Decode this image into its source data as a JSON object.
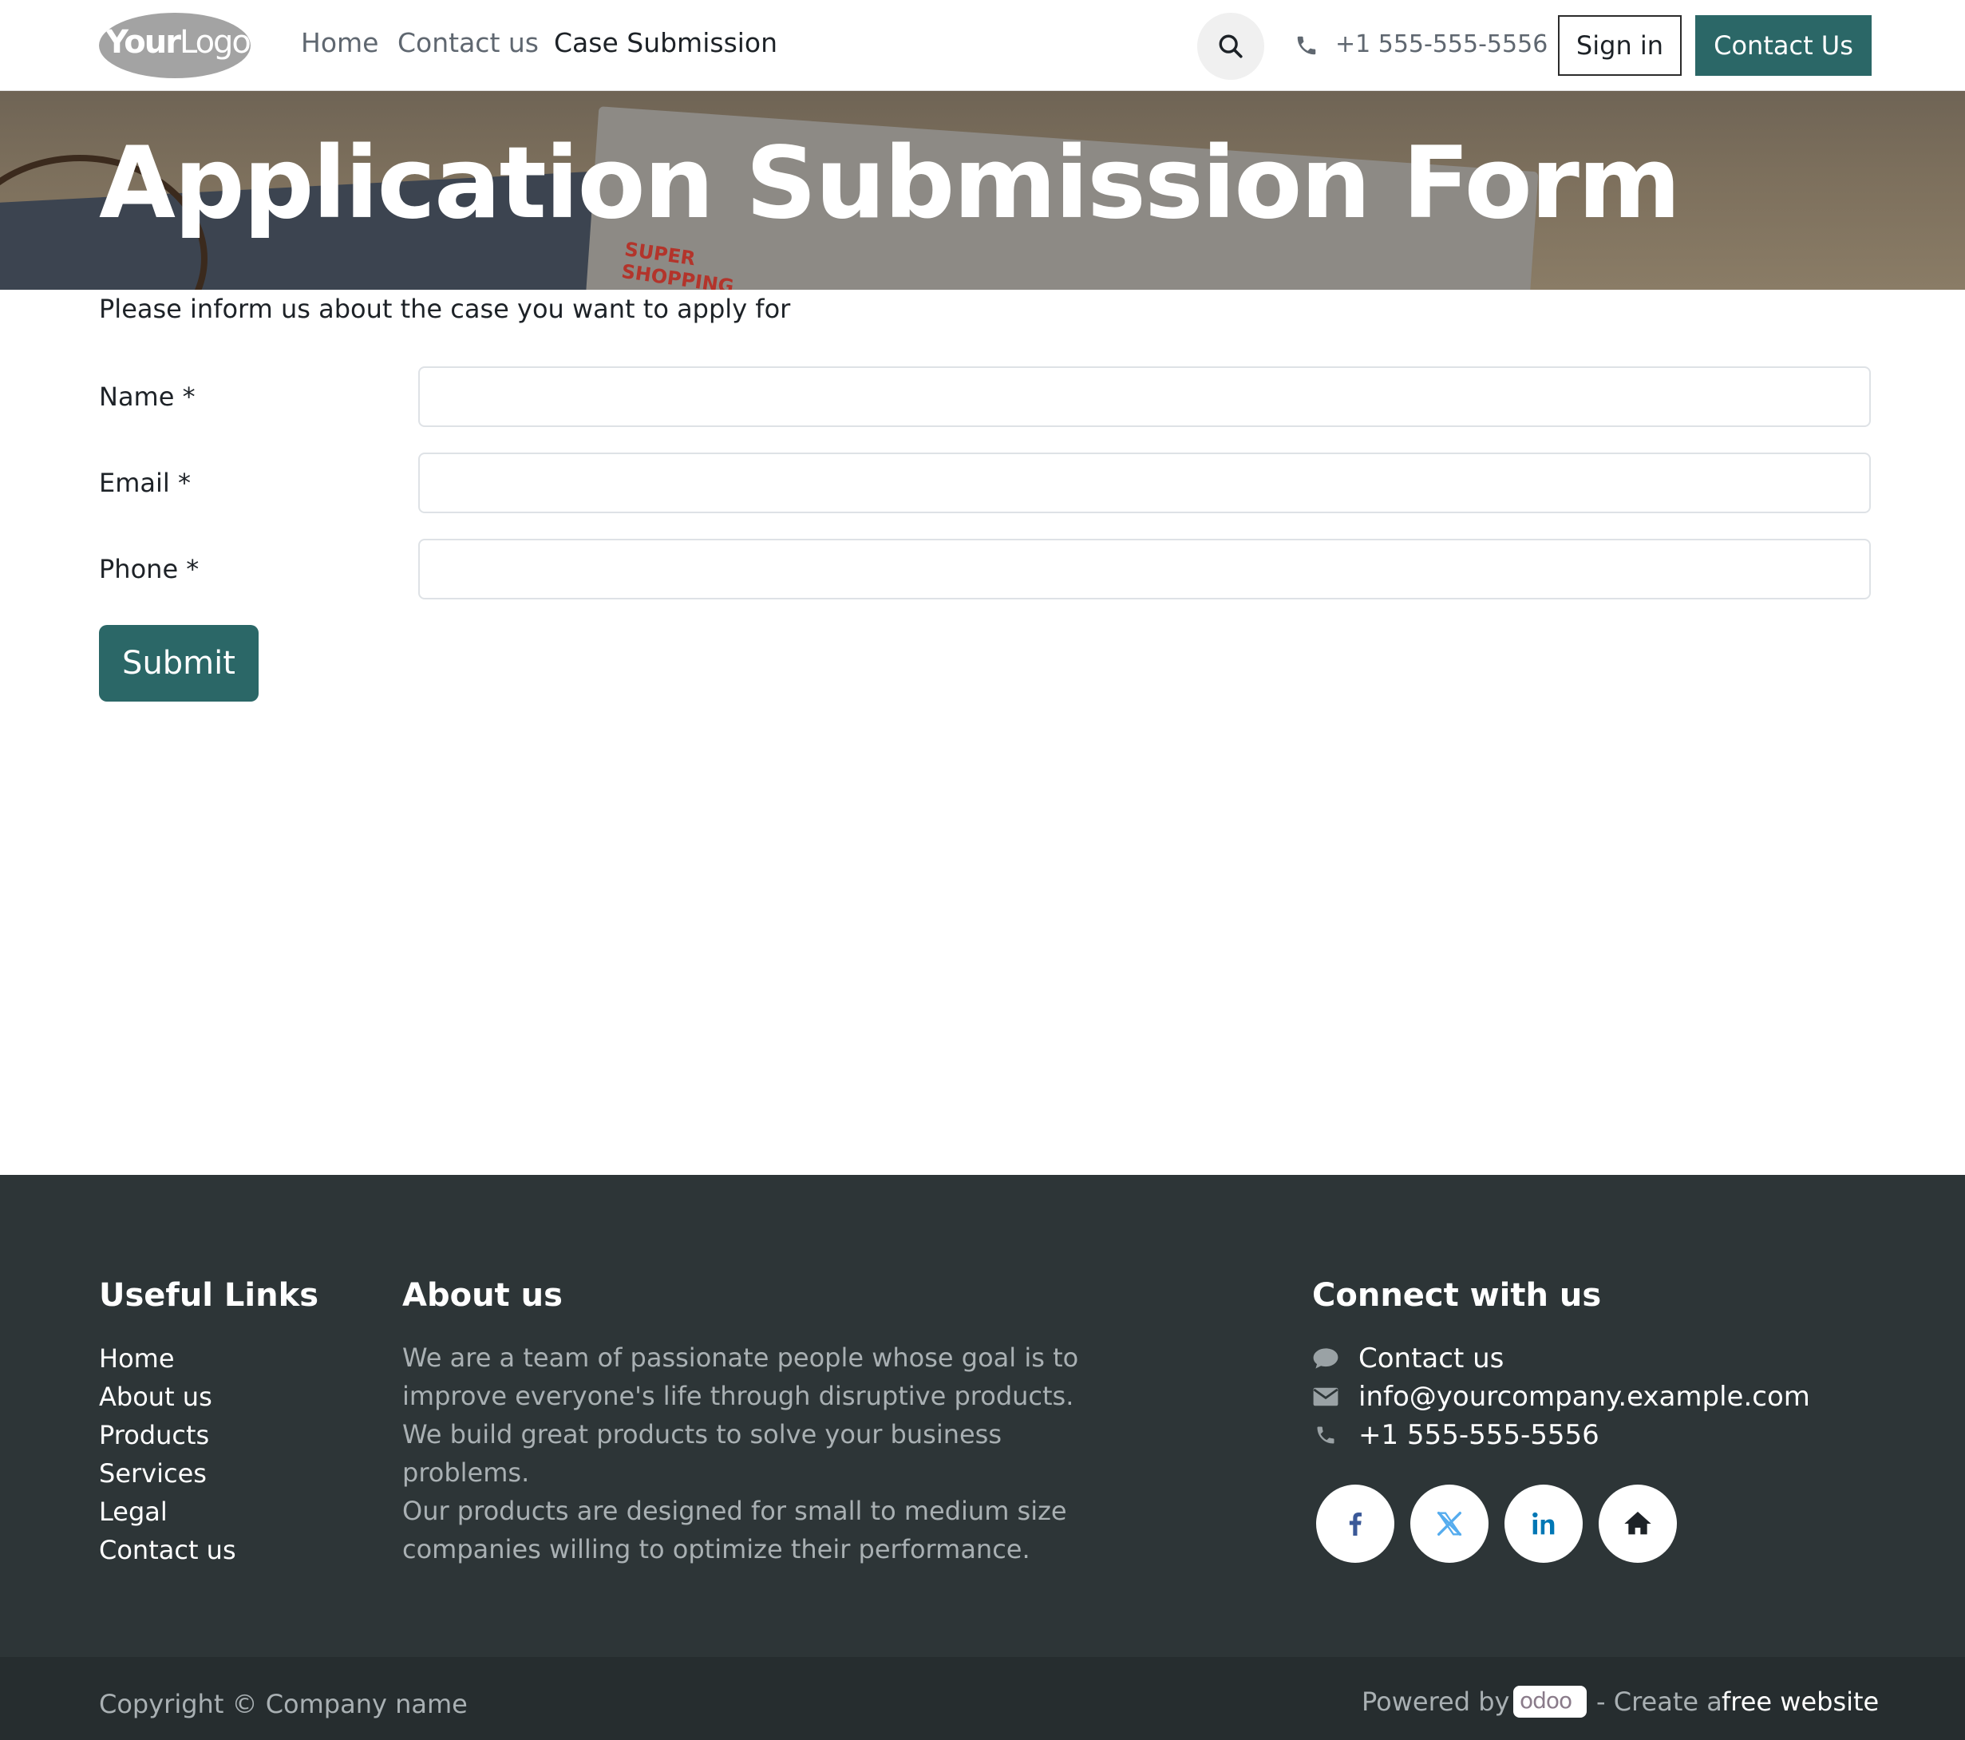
{
  "header": {
    "logo": "YourLogo",
    "logo_bold": "Your",
    "logo_light": "Logo",
    "nav": [
      {
        "label": "Home"
      },
      {
        "label": "Contact us"
      },
      {
        "label": "Case Submission",
        "active": true
      }
    ],
    "search_icon": "search-icon",
    "phone_icon": "phone-icon",
    "phone": "+1 555-555-5556",
    "sign_in": "Sign in",
    "contact_button": "Contact Us"
  },
  "banner": {
    "title": "Application Submission Form",
    "stamp_line1": "SUPER",
    "stamp_line2": "SHOPPING"
  },
  "form": {
    "intro": "Please inform us about the case you want to apply for",
    "fields": [
      {
        "label": "Name *",
        "value": "",
        "placeholder": ""
      },
      {
        "label": "Email *",
        "value": "",
        "placeholder": ""
      },
      {
        "label": "Phone *",
        "value": "",
        "placeholder": ""
      }
    ],
    "submit": "Submit"
  },
  "footer": {
    "useful_links": {
      "title": "Useful Links",
      "items": [
        "Home",
        "About us",
        "Products",
        "Services",
        "Legal",
        "Contact us"
      ]
    },
    "about": {
      "title": "About us",
      "paragraphs": [
        "We are a team of passionate people whose goal is to improve everyone's life through disruptive products. We build great products to solve your business problems.",
        "Our products are designed for small to medium size companies willing to optimize their performance."
      ]
    },
    "connect": {
      "title": "Connect with us",
      "items": [
        {
          "icon": "comment-icon",
          "label": "Contact us"
        },
        {
          "icon": "envelope-icon",
          "label": "info@yourcompany.example.com"
        },
        {
          "icon": "phone-icon",
          "label": "+1 555-555-5556"
        }
      ],
      "social": [
        "facebook-icon",
        "x-twitter-icon",
        "linkedin-icon",
        "home-icon"
      ]
    }
  },
  "copyright": {
    "text": "Copyright © Company name",
    "powered_by": "Powered by",
    "odoo": "odoo",
    "create": "- Create a",
    "free_website": "free website"
  },
  "colors": {
    "accent": "#2b6767",
    "footer_bg": "#2d3537",
    "copyright_bg": "#262d2f"
  }
}
